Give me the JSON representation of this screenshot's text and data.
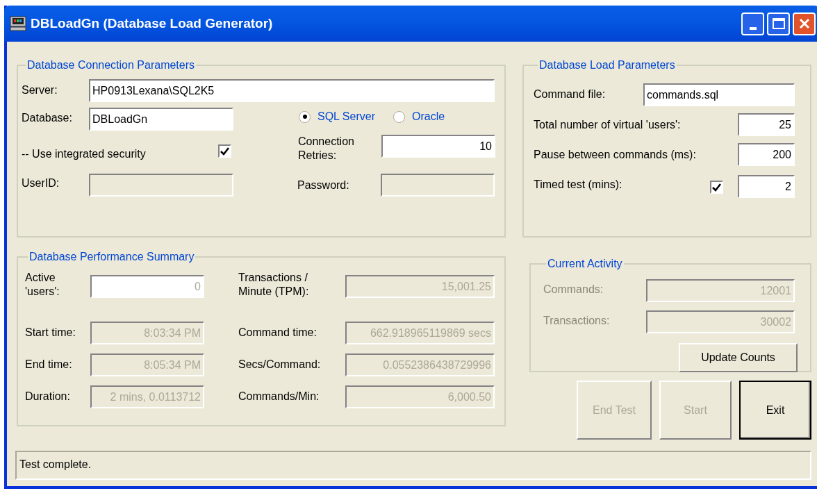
{
  "window": {
    "title": "DBLoadGn (Database Load Generator)"
  },
  "connection": {
    "title": "Database Connection Parameters",
    "server": {
      "label": "Server:",
      "value": "HP0913Lexana\\SQL2K5"
    },
    "database": {
      "label": "Database:",
      "value": "DBLoadGn"
    },
    "providers": [
      {
        "label": "SQL Server",
        "selected": true
      },
      {
        "label": "Oracle",
        "selected": false
      }
    ],
    "integrated_security": {
      "label": "-- Use integrated security",
      "checked": true
    },
    "connection_retries": {
      "label": "Connection Retries:",
      "value": "10"
    },
    "user_id": {
      "label": "UserID:",
      "disabled": true
    },
    "password": {
      "label": "Password:",
      "disabled": true
    }
  },
  "load": {
    "title": "Database Load Parameters",
    "command_file": {
      "label": "Command file:",
      "value": "commands.sql"
    },
    "virtual_users": {
      "label": "Total number of virtual 'users':",
      "value": "25"
    },
    "pause": {
      "label": "Pause between commands (ms):",
      "value": "200"
    },
    "timed_test": {
      "label": "Timed test (mins):",
      "checked": true,
      "value": "2"
    }
  },
  "performance": {
    "title": "Database Performance Summary",
    "fields": [
      {
        "label": "Active 'users':",
        "value": "0",
        "disabled": false
      },
      {
        "label": "Transactions / Minute (TPM):",
        "value": "15,001.25",
        "disabled": true
      },
      {
        "label": "Start time:",
        "value": "8:03:34 PM",
        "disabled": true
      },
      {
        "label": "Command time:",
        "value": "662.918965119869 secs",
        "disabled": true
      },
      {
        "label": "End time:",
        "value": "8:05:34 PM",
        "disabled": true
      },
      {
        "label": "Secs/Command:",
        "value": "0.0552386438729996",
        "disabled": true
      },
      {
        "label": "Duration:",
        "value": "2 mins, 0.0113712",
        "disabled": true
      },
      {
        "label": "Commands/Min:",
        "value": "6,000.50",
        "disabled": true
      }
    ]
  },
  "activity": {
    "title": "Current Activity",
    "fields": [
      {
        "label": "Commands:",
        "value": "12001",
        "disabled": true
      },
      {
        "label": "Transactions:",
        "value": "30002",
        "disabled": true
      }
    ],
    "button": "Update Counts"
  },
  "buttons": [
    {
      "label": "End Test",
      "disabled": true,
      "default": false
    },
    {
      "label": "Start",
      "disabled": true,
      "default": false
    },
    {
      "label": "Exit",
      "disabled": false,
      "default": true
    }
  ],
  "status_bar": "Test complete."
}
